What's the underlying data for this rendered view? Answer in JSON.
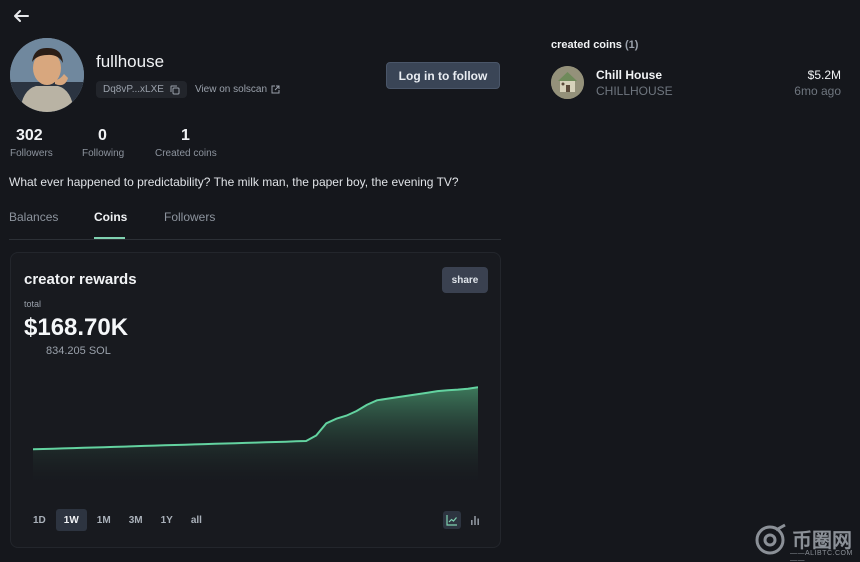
{
  "profile": {
    "username": "fullhouse",
    "address": "Dq8vP...xLXE",
    "solscan_label": "View on solscan",
    "follow_label": "Log in to follow",
    "bio": "What ever happened to predictability? The milk man, the paper boy, the evening TV?"
  },
  "stats": [
    {
      "value": "302",
      "label": "Followers"
    },
    {
      "value": "0",
      "label": "Following"
    },
    {
      "value": "1",
      "label": "Created coins"
    }
  ],
  "tabs": [
    {
      "label": "Balances",
      "active": false
    },
    {
      "label": "Coins",
      "active": true
    },
    {
      "label": "Followers",
      "active": false
    }
  ],
  "rewards": {
    "title": "creator rewards",
    "share_label": "share",
    "total_label": "total",
    "total_usd": "$168.70K",
    "total_sol": "834.205 SOL",
    "ranges": [
      "1D",
      "1W",
      "1M",
      "3M",
      "1Y",
      "all"
    ],
    "active_range": "1W",
    "views": [
      "line-chart-icon",
      "bar-chart-icon"
    ],
    "active_view": "line-chart-icon"
  },
  "chart_data": {
    "type": "area",
    "title": "",
    "xlabel": "",
    "ylabel": "",
    "x": [
      0,
      1,
      2,
      3,
      4,
      5,
      6,
      7,
      8,
      9,
      10,
      11,
      12,
      13,
      14,
      15,
      16,
      17,
      18,
      19,
      20,
      21,
      22,
      23,
      24,
      25,
      26,
      27,
      28,
      29,
      30,
      31,
      32,
      33,
      34,
      35,
      36,
      37,
      38,
      39,
      40,
      41,
      42,
      43,
      44
    ],
    "y": [
      62.0,
      62.2,
      62.4,
      62.6,
      62.8,
      63.0,
      63.2,
      63.4,
      63.6,
      63.8,
      64.0,
      64.2,
      64.4,
      64.6,
      64.8,
      65.0,
      65.2,
      65.4,
      65.6,
      65.8,
      66.0,
      66.2,
      66.4,
      66.6,
      66.8,
      67.0,
      67.2,
      67.4,
      71,
      79,
      82,
      84,
      87,
      91,
      94,
      95,
      96,
      97,
      98,
      99,
      100,
      100.6,
      101,
      101.6,
      102.5
    ],
    "line_color": "#63d3a0",
    "fill_color": "#3f7d5e",
    "grid": false
  },
  "created_coins": {
    "header": "created coins",
    "count": "(1)",
    "items": [
      {
        "name": "Chill House",
        "ticker": "CHILLHOUSE",
        "market_cap": "$5.2M",
        "age": "6mo ago"
      }
    ]
  },
  "watermark": {
    "text": "币圈网",
    "sub": "——ALIBTC.COM——"
  }
}
